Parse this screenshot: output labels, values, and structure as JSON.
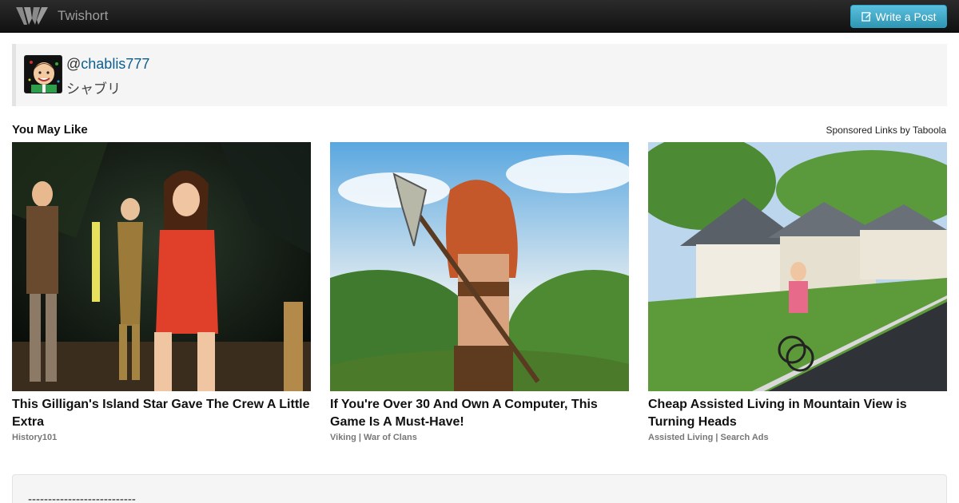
{
  "navbar": {
    "brand": "Twishort",
    "logo_icon": "twishort-logo-icon",
    "write_button": "Write a Post",
    "write_icon": "edit-icon"
  },
  "profile": {
    "handle_prefix": "@",
    "handle": "chablis777",
    "display_name": "シャブリ"
  },
  "recommendations": {
    "title": "You May Like",
    "sponsored": "Sponsored Links by Taboola",
    "items": [
      {
        "headline": "This Gilligan's Island Star Gave The Crew A Little Extra",
        "source": "History101"
      },
      {
        "headline": "If You're Over 30 And Own A Computer, This Game Is A Must-Have!",
        "source": "Viking | War of Clans"
      },
      {
        "headline": "Cheap Assisted Living in Mountain View is Turning Heads",
        "source": "Assisted Living | Search Ads"
      }
    ]
  },
  "post": {
    "text": "---------------------------"
  },
  "colors": {
    "navbar": "#1b1b1b",
    "button": "#5bc0de",
    "link": "#0b5e8f"
  }
}
